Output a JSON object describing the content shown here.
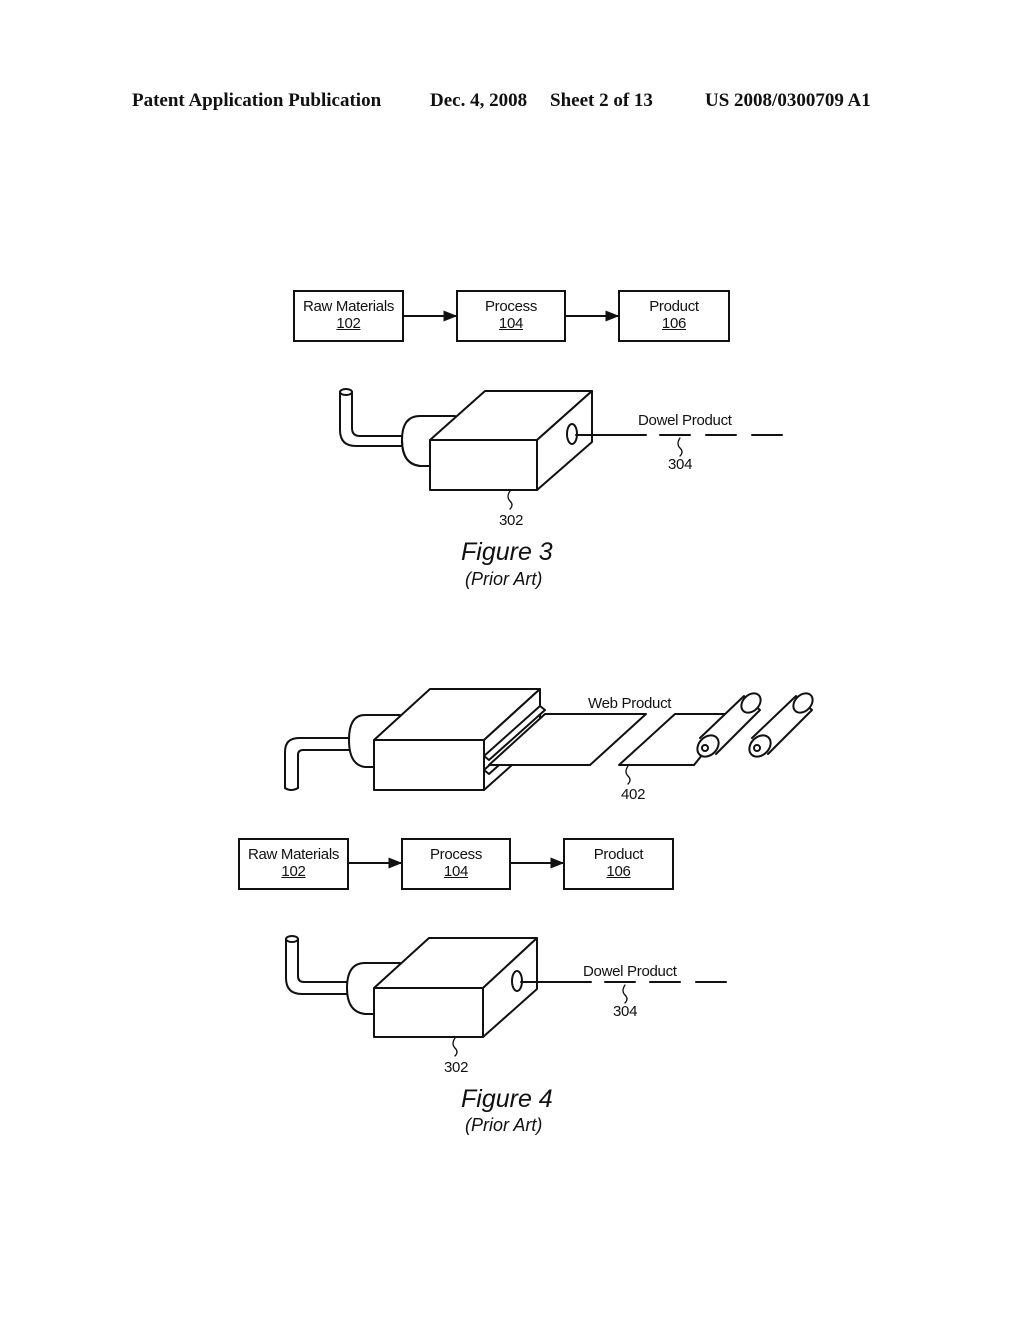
{
  "header": {
    "publication": "Patent Application Publication",
    "date": "Dec. 4, 2008",
    "sheet": "Sheet 2 of 13",
    "number": "US 2008/0300709 A1"
  },
  "figure3": {
    "flow": [
      {
        "label": "Raw Materials",
        "ref": "102"
      },
      {
        "label": "Process",
        "ref": "104"
      },
      {
        "label": "Product",
        "ref": "106"
      }
    ],
    "extruder_ref": "302",
    "dowel_label": "Dowel Product",
    "dowel_ref": "304",
    "title": "Figure 3",
    "subtitle": "(Prior Art)"
  },
  "figure4": {
    "web_label": "Web Product",
    "web_ref": "402",
    "flow": [
      {
        "label": "Raw Materials",
        "ref": "102"
      },
      {
        "label": "Process",
        "ref": "104"
      },
      {
        "label": "Product",
        "ref": "106"
      }
    ],
    "extruder_ref": "302",
    "dowel_label": "Dowel Product",
    "dowel_ref": "304",
    "title": "Figure 4",
    "subtitle": "(Prior Art)"
  }
}
